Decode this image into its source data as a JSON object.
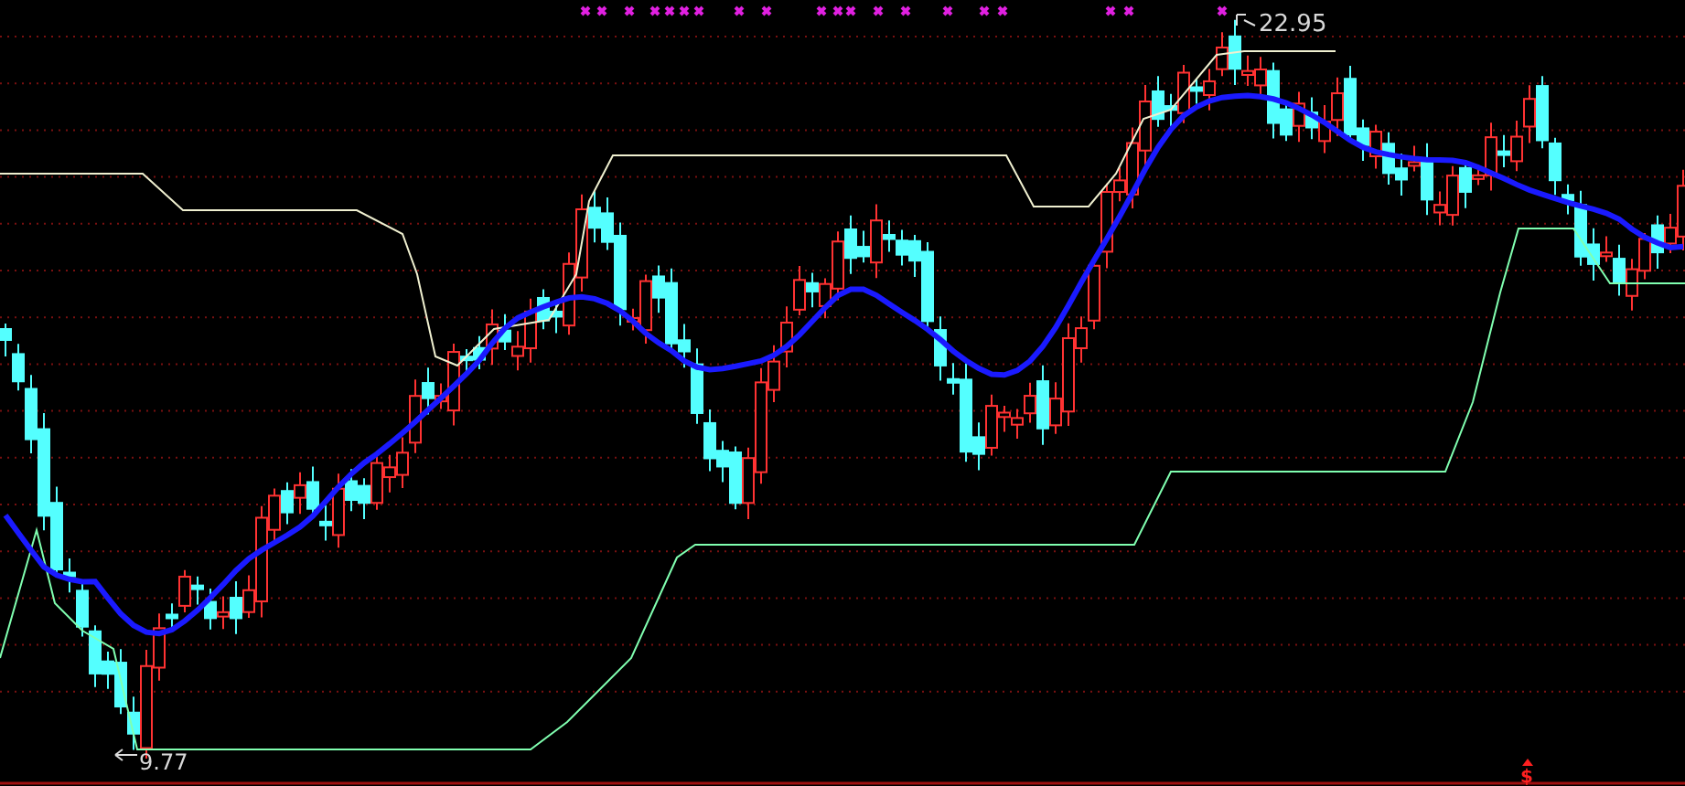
{
  "chart": {
    "high_label": "22.95",
    "low_label": "9.77",
    "signal_label": "$"
  }
}
